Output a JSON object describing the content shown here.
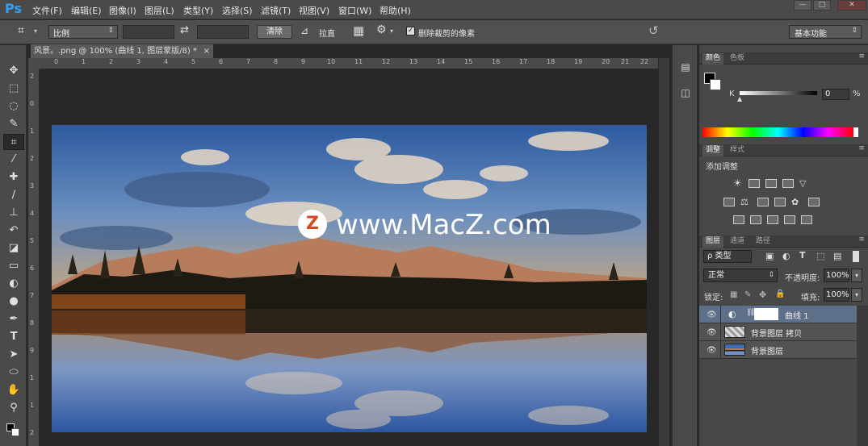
{
  "app": {
    "logo": "Ps"
  },
  "menu": [
    "文件(F)",
    "编辑(E)",
    "图像(I)",
    "图层(L)",
    "类型(Y)",
    "选择(S)",
    "滤镜(T)",
    "视图(V)",
    "窗口(W)",
    "帮助(H)"
  ],
  "window_controls": {
    "minimize": "—",
    "maximize": "□",
    "close": "✕"
  },
  "options": {
    "crop_icon": "crop-icon",
    "ratio_label": "比例",
    "swap_icon": "swap-icon",
    "clear_label": "清除",
    "straighten_label": "拉直",
    "delete_cropped_label": "删除裁剪的像素",
    "delete_cropped_checked": true,
    "workspace": "基本功能"
  },
  "document": {
    "tab_title": "风景。.png @ 100% (曲线 1, 图层蒙版/8) *",
    "tab_close": "×",
    "ruler_top": [
      "0",
      "1",
      "2",
      "3",
      "4",
      "5",
      "6",
      "7",
      "8",
      "9",
      "10",
      "11",
      "12",
      "13",
      "14",
      "15",
      "16",
      "17",
      "18",
      "19",
      "20",
      "21",
      "22"
    ],
    "ruler_left": [
      "2",
      "0",
      "1",
      "2",
      "3",
      "4",
      "5",
      "6",
      "7",
      "8",
      "9",
      "1",
      "1",
      "2"
    ],
    "watermark": "www.MacZ.com"
  },
  "color_panel": {
    "tabs": [
      "颜色",
      "色板"
    ],
    "channel": "K",
    "value": "0",
    "unit": "%"
  },
  "adjust_panel": {
    "tabs": [
      "调整",
      "样式"
    ],
    "title": "添加调整"
  },
  "layers_panel": {
    "tabs": [
      "图层",
      "通道",
      "路径"
    ],
    "filter_kind": "ρ 类型",
    "blend_mode": "正常",
    "opacity_label": "不透明度:",
    "opacity": "100%",
    "lock_label": "锁定:",
    "fill_label": "填充:",
    "fill": "100%",
    "layers": [
      {
        "name": "曲线 1"
      },
      {
        "name": "背景图层 拷贝"
      },
      {
        "name": "背景图层"
      }
    ]
  }
}
